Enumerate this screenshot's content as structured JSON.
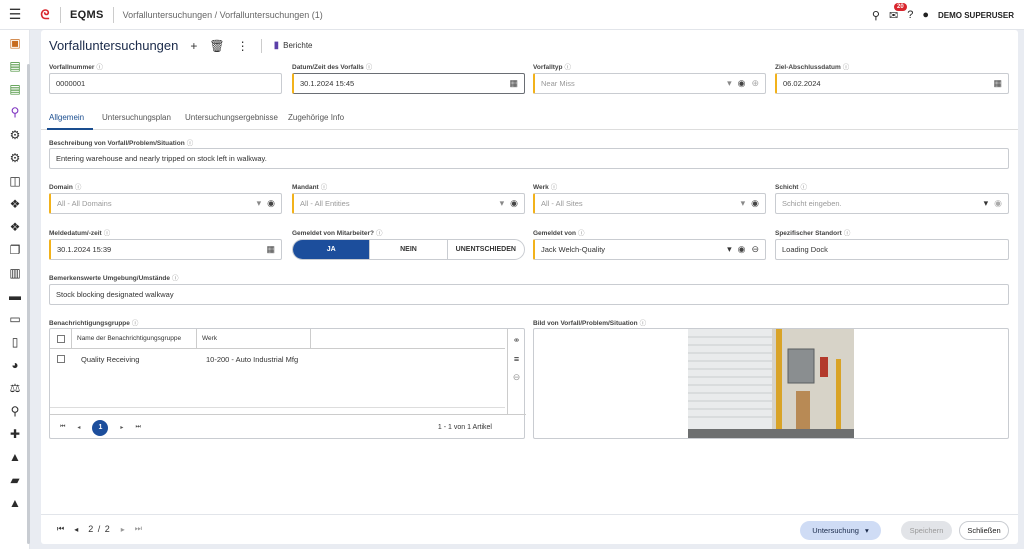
{
  "topbar": {
    "app": "EQMS",
    "breadcrumb": "Vorfalluntersuchungen / Vorfalluntersuchungen (1)",
    "notif_count": "20",
    "user": "DEMO SUPERUSER"
  },
  "header": {
    "title": "Vorfalluntersuchungen",
    "reports": "Berichte"
  },
  "fields": {
    "vorfallnummer": {
      "label": "Vorfallnummer",
      "value": "0000001"
    },
    "datum": {
      "label": "Datum/Zeit des Vorfalls",
      "value": "30.1.2024 15:45"
    },
    "vorfalltyp": {
      "label": "Vorfalltyp",
      "placeholder": "Near Miss"
    },
    "ziel": {
      "label": "Ziel-Abschlussdatum",
      "value": "06.02.2024"
    },
    "beschreibung": {
      "label": "Beschreibung von Vorfall/Problem/Situation",
      "value": "Entering warehouse and nearly tripped on stock left in walkway."
    },
    "domain": {
      "label": "Domain",
      "placeholder": "All - All Domains"
    },
    "mandant": {
      "label": "Mandant",
      "placeholder": "All - All Entities"
    },
    "werk": {
      "label": "Werk",
      "placeholder": "All - All Sites"
    },
    "schicht": {
      "label": "Schicht",
      "placeholder": "Schicht eingeben."
    },
    "meldedatum": {
      "label": "Meldedatum/-zeit",
      "value": "30.1.2024 15:39"
    },
    "gemeldet_mitarbeiter": {
      "label": "Gemeldet von Mitarbeiter?",
      "options": [
        "JA",
        "NEIN",
        "UNENTSCHIEDEN"
      ]
    },
    "gemeldet_von": {
      "label": "Gemeldet von",
      "value": "Jack Welch-Quality"
    },
    "standort": {
      "label": "Spezifischer Standort",
      "value": "Loading Dock"
    },
    "umgebung": {
      "label": "Bemerkenswerte Umgebung/Umstände",
      "value": "Stock blocking designated walkway"
    }
  },
  "tabs": [
    "Allgemein",
    "Untersuchungsplan",
    "Untersuchungsergebnisse",
    "Zugehörige Info"
  ],
  "grid": {
    "label": "Benachrichtigungsgruppe",
    "columns": [
      "Name der Benachrichtigungsgruppe",
      "Werk"
    ],
    "rows": [
      {
        "name": "Quality Receiving",
        "werk": "10-200 - Auto Industrial Mfg"
      }
    ],
    "page": "1",
    "info": "1 - 1 von 1 Artikel"
  },
  "image": {
    "label": "Bild von Vorfall/Problem/Situation"
  },
  "footer": {
    "pages": "2 / 2",
    "untersuchung": "Untersuchung",
    "save": "Speichern",
    "close": "Schließen"
  }
}
